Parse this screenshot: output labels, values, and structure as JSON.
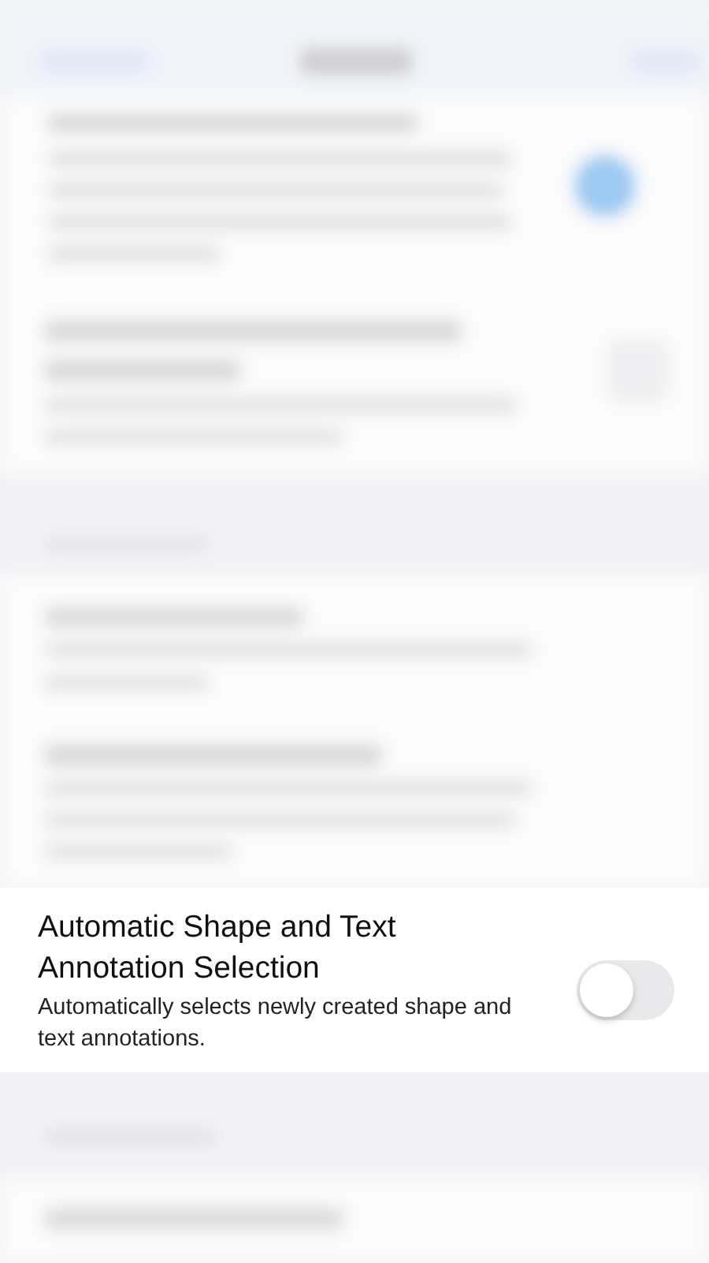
{
  "setting": {
    "title": "Automatic Shape and Text Annotation Selection",
    "description": "Automatically selects newly created shape and text annotations.",
    "on": false
  }
}
